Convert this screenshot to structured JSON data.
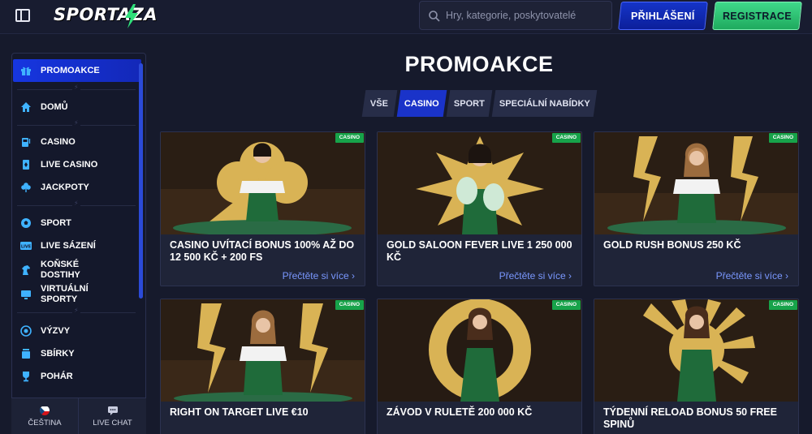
{
  "header": {
    "logo_text": "SPORTAZA",
    "search_placeholder": "Hry, kategorie, poskytovatelé",
    "login_label": "PŘIHLÁŠENÍ",
    "register_label": "REGISTRACE"
  },
  "sidebar": {
    "items": [
      {
        "label": "PROMOAKCE",
        "icon": "gift-icon"
      },
      {
        "label": "DOMŮ",
        "icon": "home-icon"
      },
      {
        "label": "CASINO",
        "icon": "slot-machine-icon"
      },
      {
        "label": "LIVE CASINO",
        "icon": "card-icon"
      },
      {
        "label": "JACKPOTY",
        "icon": "clover-icon"
      },
      {
        "label": "SPORT",
        "icon": "football-icon"
      },
      {
        "label": "LIVE SÁZENÍ",
        "icon": "live-icon"
      },
      {
        "label": "KOŇSKÉ DOSTIHY",
        "icon": "horse-icon"
      },
      {
        "label": "VIRTUÁLNÍ SPORTY",
        "icon": "monitor-icon"
      },
      {
        "label": "VÝZVY",
        "icon": "target-icon"
      },
      {
        "label": "SBÍRKY",
        "icon": "collection-icon"
      },
      {
        "label": "POHÁR",
        "icon": "trophy-icon"
      }
    ],
    "language_label": "ČEŠTINA",
    "chat_label": "LIVE CHAT"
  },
  "main": {
    "title": "PROMOAKCE",
    "tabs": [
      {
        "label": "VŠE"
      },
      {
        "label": "CASINO"
      },
      {
        "label": "SPORT"
      },
      {
        "label": "SPECIÁLNÍ NABÍDKY"
      }
    ],
    "active_tab": "CASINO",
    "read_more_label": "Přečtěte si více",
    "cards": [
      {
        "badge": "CASINO",
        "title": "CASINO UVÍTACÍ BONUS 100% AŽ DO 12 500 KČ + 200 FS"
      },
      {
        "badge": "CASINO",
        "title": "GOLD SALOON FEVER LIVE 1 250 000 KČ"
      },
      {
        "badge": "CASINO",
        "title": "GOLD RUSH BONUS 250 KČ"
      },
      {
        "badge": "CASINO",
        "title": "RIGHT ON TARGET LIVE €10"
      },
      {
        "badge": "CASINO",
        "title": "ZÁVOD V RULETĚ 200 000 KČ"
      },
      {
        "badge": "CASINO",
        "title": "TÝDENNÍ RELOAD BONUS 50 FREE SPINŮ"
      }
    ]
  },
  "colors": {
    "background": "#161a2c",
    "accent_blue": "#1636e0",
    "accent_green": "#2fc578",
    "link": "#7a98ff",
    "gold": "#d9b355",
    "dress_green": "#1f6b3a"
  }
}
